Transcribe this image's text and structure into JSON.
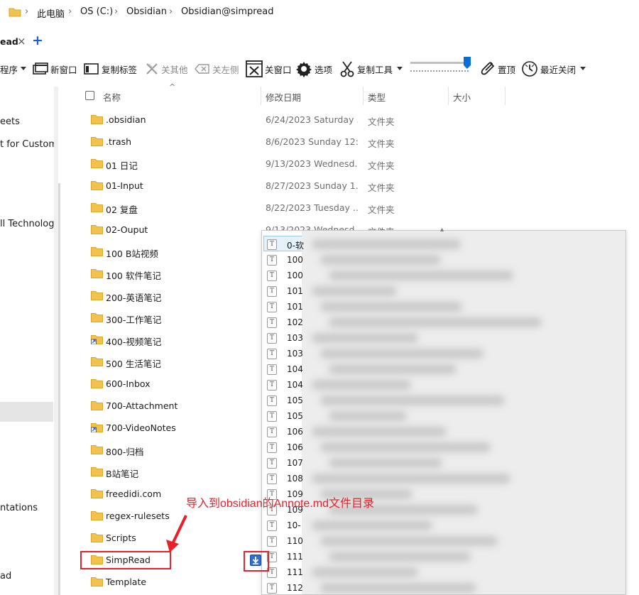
{
  "breadcrumb": {
    "items": [
      "此电脑",
      "OS (C:)",
      "Obsidian",
      "Obsidian@simpread"
    ]
  },
  "tabs": {
    "active_label": "ead",
    "close_glyph": "×",
    "add_glyph": "+"
  },
  "toolbar": {
    "items": [
      {
        "label": "序",
        "icon": "dropdown-icon"
      },
      {
        "label": "新窗口",
        "icon": "new-window-icon"
      },
      {
        "label": "复制标签",
        "icon": "copy-tab-icon"
      },
      {
        "label": "关其他",
        "icon": "close-others-icon"
      },
      {
        "label": "关左侧",
        "icon": "close-left-icon"
      },
      {
        "label": "关窗口",
        "icon": "close-window-icon"
      },
      {
        "label": "选项",
        "icon": "gear-icon"
      },
      {
        "label": "复制工具",
        "icon": "scissors-icon"
      },
      {
        "label": "置顶",
        "icon": "pin-icon"
      },
      {
        "label": "最近关闭",
        "icon": "recent-closed-icon"
      }
    ],
    "program_label": "程序"
  },
  "left_nav": {
    "items": [
      "eets",
      "t for Custome",
      "ll Technologi",
      "ntations",
      "ad"
    ]
  },
  "columns": {
    "name": "名称",
    "modified": "修改日期",
    "type": "类型",
    "size": "大小"
  },
  "files": [
    {
      "name": ".obsidian",
      "date": "6/24/2023 Saturday ...",
      "type": "文件夹",
      "shortcut": false
    },
    {
      "name": ".trash",
      "date": "8/6/2023 Sunday 12:...",
      "type": "文件夹",
      "shortcut": false
    },
    {
      "name": "01 日记",
      "date": "9/13/2023 Wednesd...",
      "type": "文件夹",
      "shortcut": false
    },
    {
      "name": "01-Input",
      "date": "8/27/2023 Sunday 1...",
      "type": "文件夹",
      "shortcut": false
    },
    {
      "name": "02 复盘",
      "date": "8/22/2023 Tuesday ...",
      "type": "文件夹",
      "shortcut": false
    },
    {
      "name": "02-Ouput",
      "date": "9/13/2023 Wednesd...",
      "type": "文件夹",
      "shortcut": false
    },
    {
      "name": "100 B站视频",
      "date": "",
      "type": "",
      "shortcut": false
    },
    {
      "name": "100 软件笔记",
      "date": "",
      "type": "",
      "shortcut": false
    },
    {
      "name": "200-英语笔记",
      "date": "",
      "type": "",
      "shortcut": false
    },
    {
      "name": "300-工作笔记",
      "date": "",
      "type": "",
      "shortcut": false
    },
    {
      "name": "400-视频笔记",
      "date": "",
      "type": "",
      "shortcut": true
    },
    {
      "name": "500 生活笔记",
      "date": "",
      "type": "",
      "shortcut": false
    },
    {
      "name": "600-Inbox",
      "date": "",
      "type": "",
      "shortcut": false
    },
    {
      "name": "700-Attachment",
      "date": "",
      "type": "",
      "shortcut": false
    },
    {
      "name": "700-VideoNotes",
      "date": "",
      "type": "",
      "shortcut": true
    },
    {
      "name": "800-归档",
      "date": "",
      "type": "",
      "shortcut": false
    },
    {
      "name": "B站笔记",
      "date": "",
      "type": "",
      "shortcut": false
    },
    {
      "name": "freedidi.com",
      "date": "",
      "type": "",
      "shortcut": false
    },
    {
      "name": "regex-rulesets",
      "date": "",
      "type": "",
      "shortcut": false
    },
    {
      "name": "Scripts",
      "date": "",
      "type": "",
      "shortcut": false
    },
    {
      "name": "SimpRead",
      "date": "",
      "type": "",
      "shortcut": false
    },
    {
      "name": "Template",
      "date": "",
      "type": "",
      "shortcut": false
    }
  ],
  "popup": {
    "items": [
      "0-软",
      "100",
      "100",
      "101",
      "101",
      "102",
      "103",
      "103",
      "104",
      "104",
      "105",
      "105",
      "106",
      "106",
      "107",
      "108",
      "109",
      "109",
      "10-",
      "110",
      "111",
      "111",
      "112"
    ]
  },
  "annotation": {
    "text": "导入到obsidian的Annote.md文件目录",
    "color": "#e8202a"
  },
  "colors": {
    "accent": "#0078d4",
    "folder": "#f2c14e",
    "highlight": "#e8202a"
  }
}
